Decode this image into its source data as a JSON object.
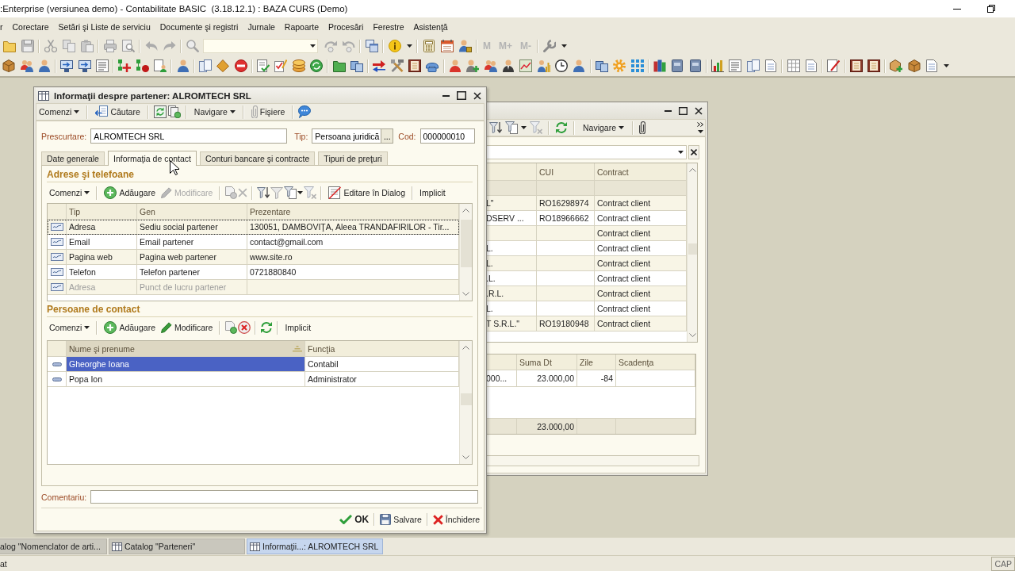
{
  "window": {
    "title": ":Enterprise (versiunea demo) - Contabilitate BASIC  (3.18.12.1) : BAZA CURS (Demo)"
  },
  "menu": [
    "r",
    "Corectare",
    "Setări şi Liste de serviciu",
    "Documente şi registri",
    "Jurnale",
    "Rapoarte",
    "Procesări",
    "Ferestre",
    "Asistenţă"
  ],
  "toolbar": {
    "memory_buttons": [
      {
        "label": "M",
        "disabled": true
      },
      {
        "label": "M+",
        "disabled": true
      },
      {
        "label": "M-",
        "disabled": true
      }
    ]
  },
  "catalog_window": {
    "toolbar": {
      "navigation_menu": "Navigare"
    },
    "partners_table": {
      "columns": [
        "CUI",
        "Contract"
      ],
      "rows": [
        {
          "column_1": "L\"",
          "cui": "RO16298974",
          "contract": "Contract client"
        },
        {
          "column_1": "DSERV ...",
          "cui": "RO18966662",
          "contract": "Contract client"
        },
        {
          "contract": "Contract client"
        },
        {
          "column_1": "L.",
          "contract": "Contract client"
        },
        {
          "column_1": "L.",
          "contract": "Contract client"
        },
        {
          "column_1": ".L.",
          "contract": "Contract client"
        },
        {
          "column_1": ".R.L.",
          "contract": "Contract client"
        },
        {
          "column_1": "L.",
          "contract": "Contract client"
        },
        {
          "column_1": "T S.R.L.\"",
          "cui": "RO19180948",
          "contract": "Contract client"
        }
      ]
    },
    "balances_table": {
      "columns": [
        "Suma Dt",
        "Zile",
        "Scadenţa"
      ],
      "rows": [
        {
          "column_1": "000...",
          "suma_dt": "23.000,00",
          "zile": "-84"
        }
      ],
      "totals": {
        "suma_dt": "23.000,00"
      }
    }
  },
  "dialog": {
    "title": "Informaţii despre partener: ALROMTECH SRL",
    "toolbar": {
      "commands_menu": "Comenzi",
      "search_button": "Căutare",
      "navigation_menu": "Navigare",
      "files_button": "Fişiere"
    },
    "fields": {
      "abbreviation": {
        "label": "Prescurtare:",
        "value": "ALROMTECH SRL"
      },
      "type": {
        "label": "Tip:",
        "value": "Persoana juridică",
        "browse_button": "..."
      },
      "code": {
        "label": "Cod:",
        "value": "000000010"
      }
    },
    "tabs": [
      {
        "label": "Date generale",
        "selected": false
      },
      {
        "label": "Informaţia de contact",
        "selected": true
      },
      {
        "label": "Conturi bancare şi contracte",
        "selected": false
      },
      {
        "label": "Tipuri de preţuri",
        "selected": false
      }
    ],
    "addresses": {
      "heading": "Adrese şi telefoane",
      "toolbar": {
        "commands_menu": "Comenzi",
        "add_button": {
          "label": "Adăugare",
          "disabled": false
        },
        "edit_button": {
          "label": "Modificare",
          "disabled": true
        },
        "dialog_edit_button": "Editare în Dialog",
        "default_button": "Implicit"
      },
      "columns": [
        "Tip",
        "Gen",
        "Prezentare"
      ],
      "rows": [
        {
          "tip": "Adresa",
          "gen": "Sediu social partener",
          "prezentare": "130051, DAMBOVIŢA, Aleea TRANDAFIRILOR - Tir...",
          "selected": true,
          "disabled": false
        },
        {
          "tip": "Email",
          "gen": "Email partener",
          "prezentare": "contact@gmail.com",
          "selected": false,
          "disabled": false
        },
        {
          "tip": "Pagina web",
          "gen": "Pagina web partener",
          "prezentare": "www.site.ro",
          "selected": false,
          "disabled": false
        },
        {
          "tip": "Telefon",
          "gen": "Telefon partener",
          "prezentare": "0721880840",
          "selected": false,
          "disabled": false
        },
        {
          "tip": "Adresa",
          "gen": "Punct de lucru partener",
          "selected": false,
          "disabled": true
        }
      ]
    },
    "contacts": {
      "heading": "Persoane de contact",
      "toolbar": {
        "commands_menu": "Comenzi",
        "add_button": {
          "label": "Adăugare",
          "disabled": false
        },
        "edit_button": {
          "label": "Modificare",
          "disabled": false
        },
        "default_button": "Implicit"
      },
      "columns": [
        {
          "label": "Nume şi prenume",
          "sorted": true
        },
        {
          "label": "Funcţia",
          "sorted": false
        }
      ],
      "rows": [
        {
          "nume": "Gheorghe Ioana",
          "functia": "Contabil",
          "selected": true
        },
        {
          "nume": "Popa Ion",
          "functia": "Administrator",
          "selected": false
        }
      ]
    },
    "comment": {
      "label": "Comentariu:"
    },
    "buttons": [
      {
        "label": "OK",
        "kind": "ok"
      },
      {
        "label": "Salvare",
        "kind": "save"
      },
      {
        "label": "Închidere",
        "kind": "close"
      }
    ]
  },
  "taskbar": [
    {
      "label": "alog \"Nomenclator de arti...",
      "clipped": true,
      "selected": false
    },
    {
      "label": "Catalog \"Parteneri\"",
      "clipped": false,
      "selected": false
    },
    {
      "label": "Informaţii...: ALROMTECH SRL",
      "clipped": false,
      "selected": true
    }
  ],
  "status_bar": {
    "text": "at",
    "indicator": "CAP"
  }
}
